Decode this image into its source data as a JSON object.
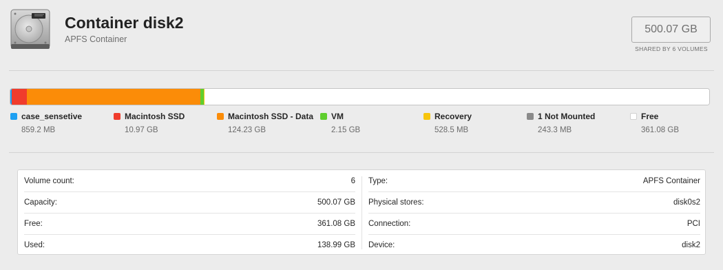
{
  "header": {
    "title": "Container disk2",
    "subtitle": "APFS Container",
    "capacity": "500.07 GB",
    "shared_note": "SHARED BY 6 VOLUMES",
    "icon": "hard-drive-icon"
  },
  "usage_bar": {
    "total_gb": 500.07,
    "segments": [
      {
        "name": "case_sensetive",
        "gb": 0.8592,
        "color": "#1ea0f2"
      },
      {
        "name": "Macintosh SSD",
        "gb": 10.97,
        "color": "#f03c2c"
      },
      {
        "name": "Macintosh SSD - Data",
        "gb": 124.23,
        "color": "#fb8c08"
      },
      {
        "name": "VM",
        "gb": 2.15,
        "color": "#5fce2e"
      },
      {
        "name": "Recovery",
        "gb": 0.5285,
        "color": "#f7c50d"
      },
      {
        "name": "1 Not Mounted",
        "gb": 0.2433,
        "color": "#8a8a8a"
      },
      {
        "name": "Free",
        "gb": 361.08,
        "color": "#ffffff"
      }
    ]
  },
  "legend": [
    {
      "name": "case_sensetive",
      "size": "859.2 MB",
      "color": "#1ea0f2"
    },
    {
      "name": "Macintosh SSD",
      "size": "10.97 GB",
      "color": "#f03c2c"
    },
    {
      "name": "Macintosh SSD - Data",
      "size": "124.23 GB",
      "color": "#fb8c08"
    },
    {
      "name": "VM",
      "size": "2.15 GB",
      "color": "#5fce2e"
    },
    {
      "name": "Recovery",
      "size": "528.5 MB",
      "color": "#f7c50d"
    },
    {
      "name": "1 Not Mounted",
      "size": "243.3 MB",
      "color": "#8a8a8a"
    },
    {
      "name": "Free",
      "size": "361.08 GB",
      "color": "#ffffff"
    }
  ],
  "info": {
    "left": [
      {
        "label": "Volume count:",
        "value": "6"
      },
      {
        "label": "Capacity:",
        "value": "500.07 GB"
      },
      {
        "label": "Free:",
        "value": "361.08 GB"
      },
      {
        "label": "Used:",
        "value": "138.99 GB"
      }
    ],
    "right": [
      {
        "label": "Type:",
        "value": "APFS Container"
      },
      {
        "label": "Physical stores:",
        "value": "disk0s2"
      },
      {
        "label": "Connection:",
        "value": "PCI"
      },
      {
        "label": "Device:",
        "value": "disk2"
      }
    ]
  }
}
